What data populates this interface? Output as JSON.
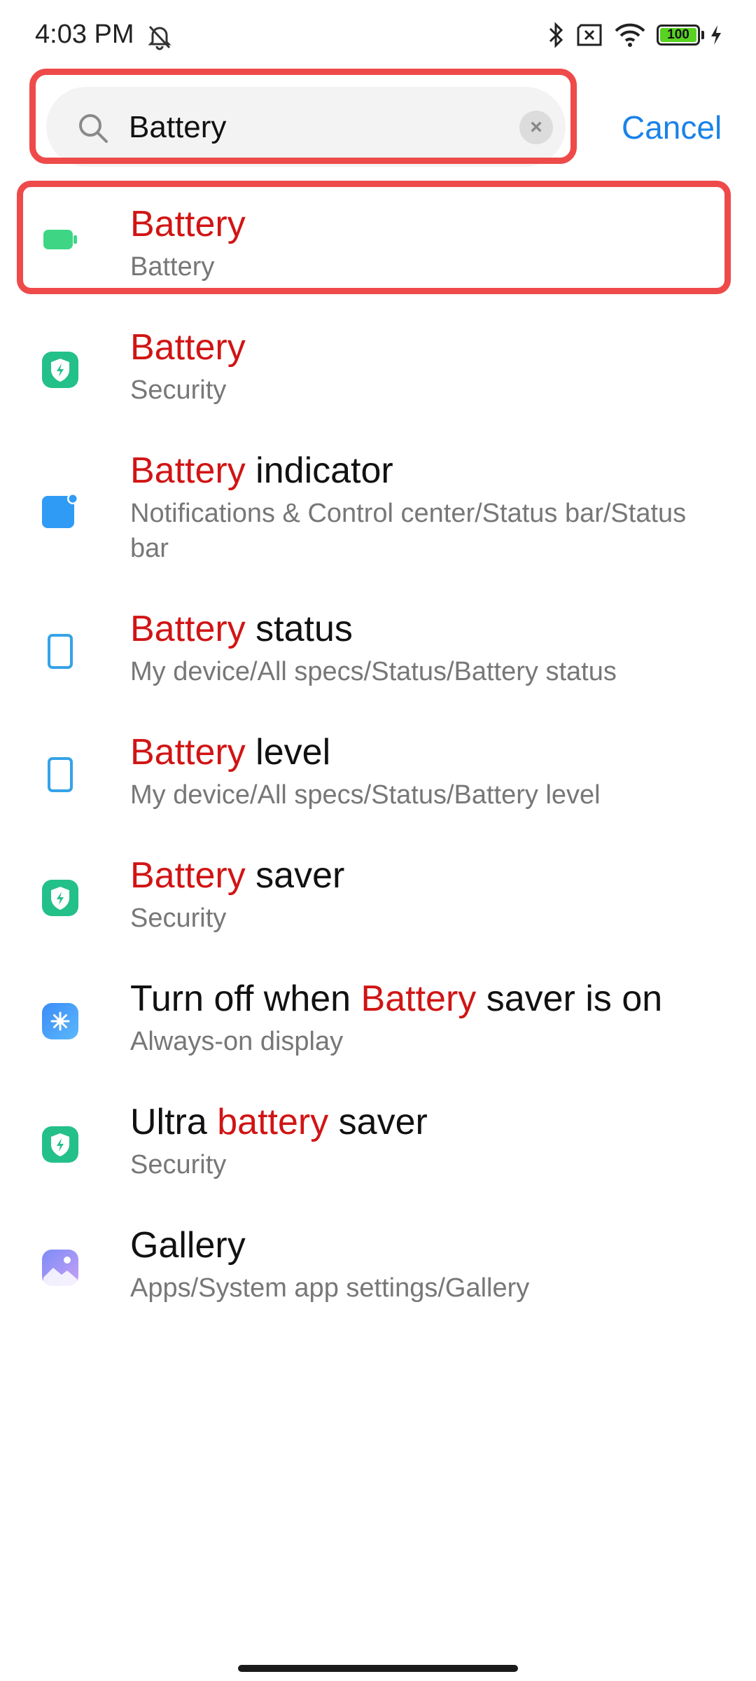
{
  "status_bar": {
    "time": "4:03 PM",
    "battery_level": "100",
    "icons": [
      "mute-alarm-icon",
      "bluetooth-icon",
      "sim-off-icon",
      "wifi-icon",
      "battery-icon",
      "charging-icon"
    ]
  },
  "search": {
    "query": "Battery",
    "cancel_label": "Cancel",
    "clear_symbol": "×"
  },
  "results": [
    {
      "pre": "",
      "hl": "Battery",
      "post": "",
      "sub": "Battery",
      "icon": "battery-icon"
    },
    {
      "pre": "",
      "hl": "Battery",
      "post": "",
      "sub": "Security",
      "icon": "security-shield-icon"
    },
    {
      "pre": "",
      "hl": "Battery",
      "post": " indicator",
      "sub": "Notifications & Control center/Status bar/Status bar",
      "icon": "notification-icon"
    },
    {
      "pre": "",
      "hl": "Battery",
      "post": " status",
      "sub": "My device/All specs/Status/Battery status",
      "icon": "device-icon"
    },
    {
      "pre": "",
      "hl": "Battery",
      "post": " level",
      "sub": "My device/All specs/Status/Battery level",
      "icon": "device-icon"
    },
    {
      "pre": "",
      "hl": "Battery",
      "post": " saver",
      "sub": "Security",
      "icon": "security-shield-icon"
    },
    {
      "pre": "Turn off when ",
      "hl": "Battery",
      "post": " saver is on",
      "sub": "Always-on display",
      "icon": "always-on-display-icon"
    },
    {
      "pre": "Ultra ",
      "hl": "battery",
      "post": " saver",
      "sub": "Security",
      "icon": "security-shield-icon"
    },
    {
      "pre": "",
      "hl": "",
      "post": "Gallery",
      "sub": "Apps/System app settings/Gallery",
      "icon": "gallery-icon"
    }
  ],
  "colors": {
    "highlight": "#d11414",
    "accent": "#1a82e8",
    "annotation_outline": "#ee4a4a"
  }
}
